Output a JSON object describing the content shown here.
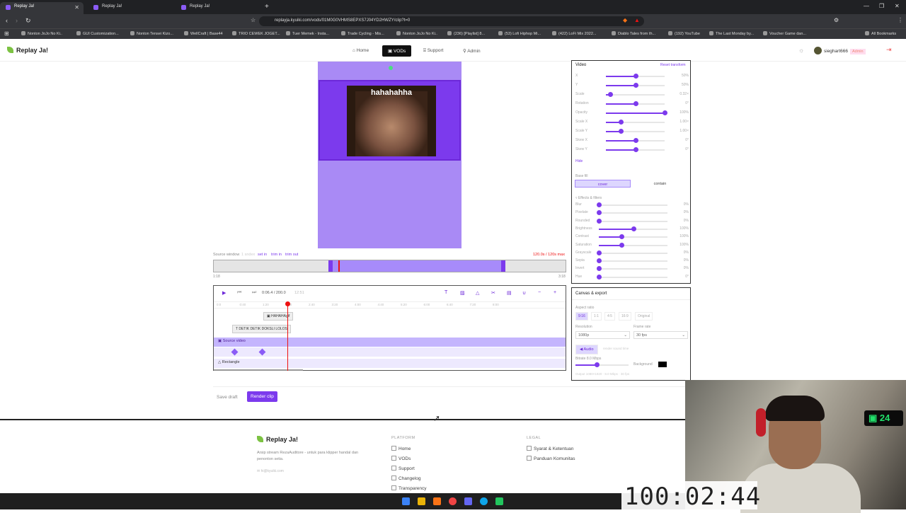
{
  "browser": {
    "tabs": [
      {
        "label": "Replay Ja!"
      },
      {
        "label": "Replay Ja!"
      },
      {
        "label": "Replay Ja!"
      }
    ],
    "url": "replayja.kyuiki.com/vods/01M0G0VHMS8EPXS7J04YD2HWZY/clip?t=0",
    "bookmarks": [
      "Nonton JoJo No Ki..",
      "GUI Customization...",
      "Nonton Tensei Kizo...",
      "WellCraft | Base44",
      "TRIO CEWEK JOGET...",
      "Tuer Memek - Insta...",
      "Trade Cycling - Mis...",
      "Nonton JoJo No Ki..",
      "(236) [Playlist] 8...",
      "(53) Lofi Hiphop Mi...",
      "(422) LoFi Mix 2022...",
      "Diablo Tales from th...",
      "(192) YouTube",
      "The Last Monday by...",
      "Voucher Game dan..."
    ],
    "all_bookmarks": "All Bookmarks"
  },
  "site": {
    "logo": "Replay Ja!",
    "nav": [
      {
        "label": "Home"
      },
      {
        "label": "VODs"
      },
      {
        "label": "Support"
      },
      {
        "label": "Admin"
      }
    ],
    "user": "sieghart666",
    "role": "Admin"
  },
  "preview": {
    "gif_caption": "hahahahha"
  },
  "trim": {
    "source_window": "Source window",
    "tabs": [
      "1 sndex",
      "set in",
      "trim in",
      "trim out"
    ],
    "range": "120.0s / 120s max",
    "tick_start": "1:18",
    "tick_end": "3:18"
  },
  "timeline": {
    "timecode": "0:06.4 / 200.0",
    "fps": "12:51",
    "ruler": [
      "0:0",
      "0:40",
      "1:20",
      "2:00",
      "2:40",
      "3:20",
      "4:00",
      "4:40",
      "5:20",
      "6:00",
      "6:40",
      "7:20",
      "8:00"
    ],
    "tracks": [
      {
        "label": "HAHAHAgif"
      },
      {
        "label": "DETIK DETIK DOKSLI LOLOS"
      },
      {
        "label": "Source video"
      },
      {
        "label": "Rectangle"
      }
    ]
  },
  "actions": {
    "save": "Save draft",
    "render": "Render clip"
  },
  "video_panel": {
    "title": "Video",
    "reset": "Reset transform",
    "hide": "Hide",
    "transform": [
      {
        "label": "X",
        "value": "50%",
        "level": 0.5
      },
      {
        "label": "Y",
        "value": "50%",
        "level": 0.5
      },
      {
        "label": "Scale",
        "value": "0.32×",
        "level": 0.07
      },
      {
        "label": "Rotation",
        "value": "0°",
        "level": 0.5
      },
      {
        "label": "Opacity",
        "value": "100%",
        "level": 1.0
      },
      {
        "label": "Scale X",
        "value": "1.00×",
        "level": 0.25
      },
      {
        "label": "Scale Y",
        "value": "1.00×",
        "level": 0.25
      },
      {
        "label": "Skew X",
        "value": "0°",
        "level": 0.5
      },
      {
        "label": "Skew Y",
        "value": "0°",
        "level": 0.5
      }
    ],
    "base_fill": "Base fill",
    "fit": [
      "cover",
      "contain"
    ],
    "effects_title": "Effects & filters",
    "effects": [
      {
        "label": "Blur",
        "value": "0%",
        "level": 0
      },
      {
        "label": "Pixelate",
        "value": "0%",
        "level": 0
      },
      {
        "label": "Rounded",
        "value": "0%",
        "level": 0
      },
      {
        "label": "Brightness",
        "value": "100%",
        "level": 0.5
      },
      {
        "label": "Contrast",
        "value": "100%",
        "level": 0.33
      },
      {
        "label": "Saturation",
        "value": "100%",
        "level": 0.33
      },
      {
        "label": "Grayscale",
        "value": "0%",
        "level": 0
      },
      {
        "label": "Sepia",
        "value": "0%",
        "level": 0
      },
      {
        "label": "Invert",
        "value": "0%",
        "level": 0
      },
      {
        "label": "Hue",
        "value": "0°",
        "level": 0
      }
    ]
  },
  "export_panel": {
    "title": "Canvas & export",
    "aspect_label": "Aspect ratio",
    "aspects": [
      "9:16",
      "1:1",
      "4:5",
      "16:9",
      "Original"
    ],
    "resolution_label": "Resolution",
    "resolution": "1080p",
    "framerate_label": "Frame rate",
    "framerate": "30 fps",
    "audio": "Audio",
    "audio_note": "render sound time",
    "bitrate_label": "Bitrate 8.0 Mbps",
    "background_label": "Background",
    "bitrate_level": 0.4,
    "output_note": "Output 1080×1920 · 8.0 Mbps · 30 fps"
  },
  "footer": {
    "logo": "Replay Ja!",
    "tagline": "Arsip stream RezaAuditore - untuk para klipper handal dan penonton setia.",
    "email": "hi@kyuiki.com",
    "platform_title": "PLATFORM",
    "platform_links": [
      "Home",
      "VODs",
      "Support",
      "Changelog",
      "Transparency"
    ],
    "legal_title": "LEGAL",
    "legal_links": [
      "Syarat & Ketentuan",
      "Panduan Komunitas"
    ]
  },
  "overlay": {
    "timer": "100:02:44",
    "counter": "24"
  }
}
